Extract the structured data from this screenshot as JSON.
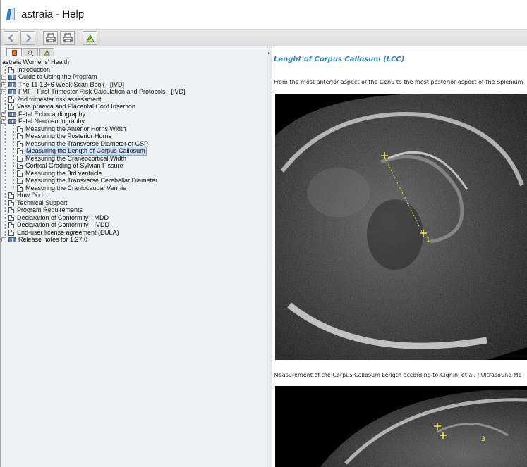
{
  "window": {
    "title": "astraia - Help"
  },
  "toolbar": {
    "buttons": [
      {
        "name": "back-button",
        "icon": "chevron-left-icon"
      },
      {
        "name": "forward-button",
        "icon": "chevron-right-icon"
      },
      {
        "name": "print-button",
        "icon": "printer-icon"
      },
      {
        "name": "print-setup-button",
        "icon": "printer-icon"
      },
      {
        "name": "options-button",
        "icon": "options-icon"
      }
    ]
  },
  "nav_tabs": [
    {
      "name": "tab-contents",
      "icon": "book-icon",
      "active": true
    },
    {
      "name": "tab-search",
      "icon": "search-icon",
      "active": false
    },
    {
      "name": "tab-favorites",
      "icon": "favorites-icon",
      "active": false
    }
  ],
  "tree": {
    "root": "astraia Womens' Health",
    "items": [
      {
        "label": "Introduction",
        "type": "page",
        "level": 1
      },
      {
        "label": "Guide to Using the Program",
        "type": "book",
        "level": 1,
        "expandable": true,
        "expanded": false
      },
      {
        "label": "The 11-13+6 Week Scan Book - [IVD]",
        "type": "book",
        "level": 1,
        "expandable": true,
        "expanded": false
      },
      {
        "label": "FMF - First Trimester Risk Calculation and Protocols - [IVD]",
        "type": "book",
        "level": 1,
        "expandable": true,
        "expanded": false
      },
      {
        "label": "2nd trimester risk assessment",
        "type": "page",
        "level": 1
      },
      {
        "label": "Vasa praevia and Placental Cord Insertion",
        "type": "page",
        "level": 1
      },
      {
        "label": "Fetal Echocardiography",
        "type": "book",
        "level": 1,
        "expandable": true,
        "expanded": false
      },
      {
        "label": "Fetal Neurosonography",
        "type": "book",
        "level": 1,
        "expandable": true,
        "expanded": true
      },
      {
        "label": "Measuring the Anterior Horns Width",
        "type": "page",
        "level": 2
      },
      {
        "label": "Measuring the Posterior Horns",
        "type": "page",
        "level": 2
      },
      {
        "label": "Measuring the Transverse Diameter of CSP",
        "type": "page",
        "level": 2
      },
      {
        "label": "Measuring the Length of Corpus Callosum",
        "type": "page",
        "level": 2,
        "selected": true
      },
      {
        "label": "Measuring the Craneocortical Width",
        "type": "page",
        "level": 2
      },
      {
        "label": "Cortical Grading of Sylvian Fissure",
        "type": "page",
        "level": 2
      },
      {
        "label": "Measuring the 3rd ventricle",
        "type": "page",
        "level": 2
      },
      {
        "label": "Measuring the Transverse Cerebellar Diameter",
        "type": "page",
        "level": 2
      },
      {
        "label": "Measuring the Craniocaudal Vermis",
        "type": "page",
        "level": 2
      },
      {
        "label": "How Do I...",
        "type": "page",
        "level": 1
      },
      {
        "label": "Technical Support",
        "type": "page",
        "level": 1
      },
      {
        "label": "Program Requirements",
        "type": "page",
        "level": 1
      },
      {
        "label": "Declaration of Conformity - MDD",
        "type": "page",
        "level": 1
      },
      {
        "label": "Declaration of Conformity - IVDD",
        "type": "page",
        "level": 1
      },
      {
        "label": "End-user license agreement (EULA)",
        "type": "page",
        "level": 1
      },
      {
        "label": "Release notes for 1.27.0",
        "type": "book",
        "level": 1,
        "expandable": true,
        "expanded": false
      }
    ]
  },
  "content": {
    "title": "Lenght of Corpus Callosum (LCC)",
    "description": "From the most anterior aspect of the Genu to the most posterior aspect of the Splenium",
    "caption": "Measurement of the Corpus Callosum Length according to Cignini et al. J Ultrasound Me",
    "image1_markers": [
      "1"
    ],
    "image2_markers": [
      "3"
    ]
  },
  "colors": {
    "title_accent": "#2f7fc1",
    "selection": "#cfe0f7",
    "pane_bg": "#eef2f2",
    "caliper": "#f2f24a"
  }
}
